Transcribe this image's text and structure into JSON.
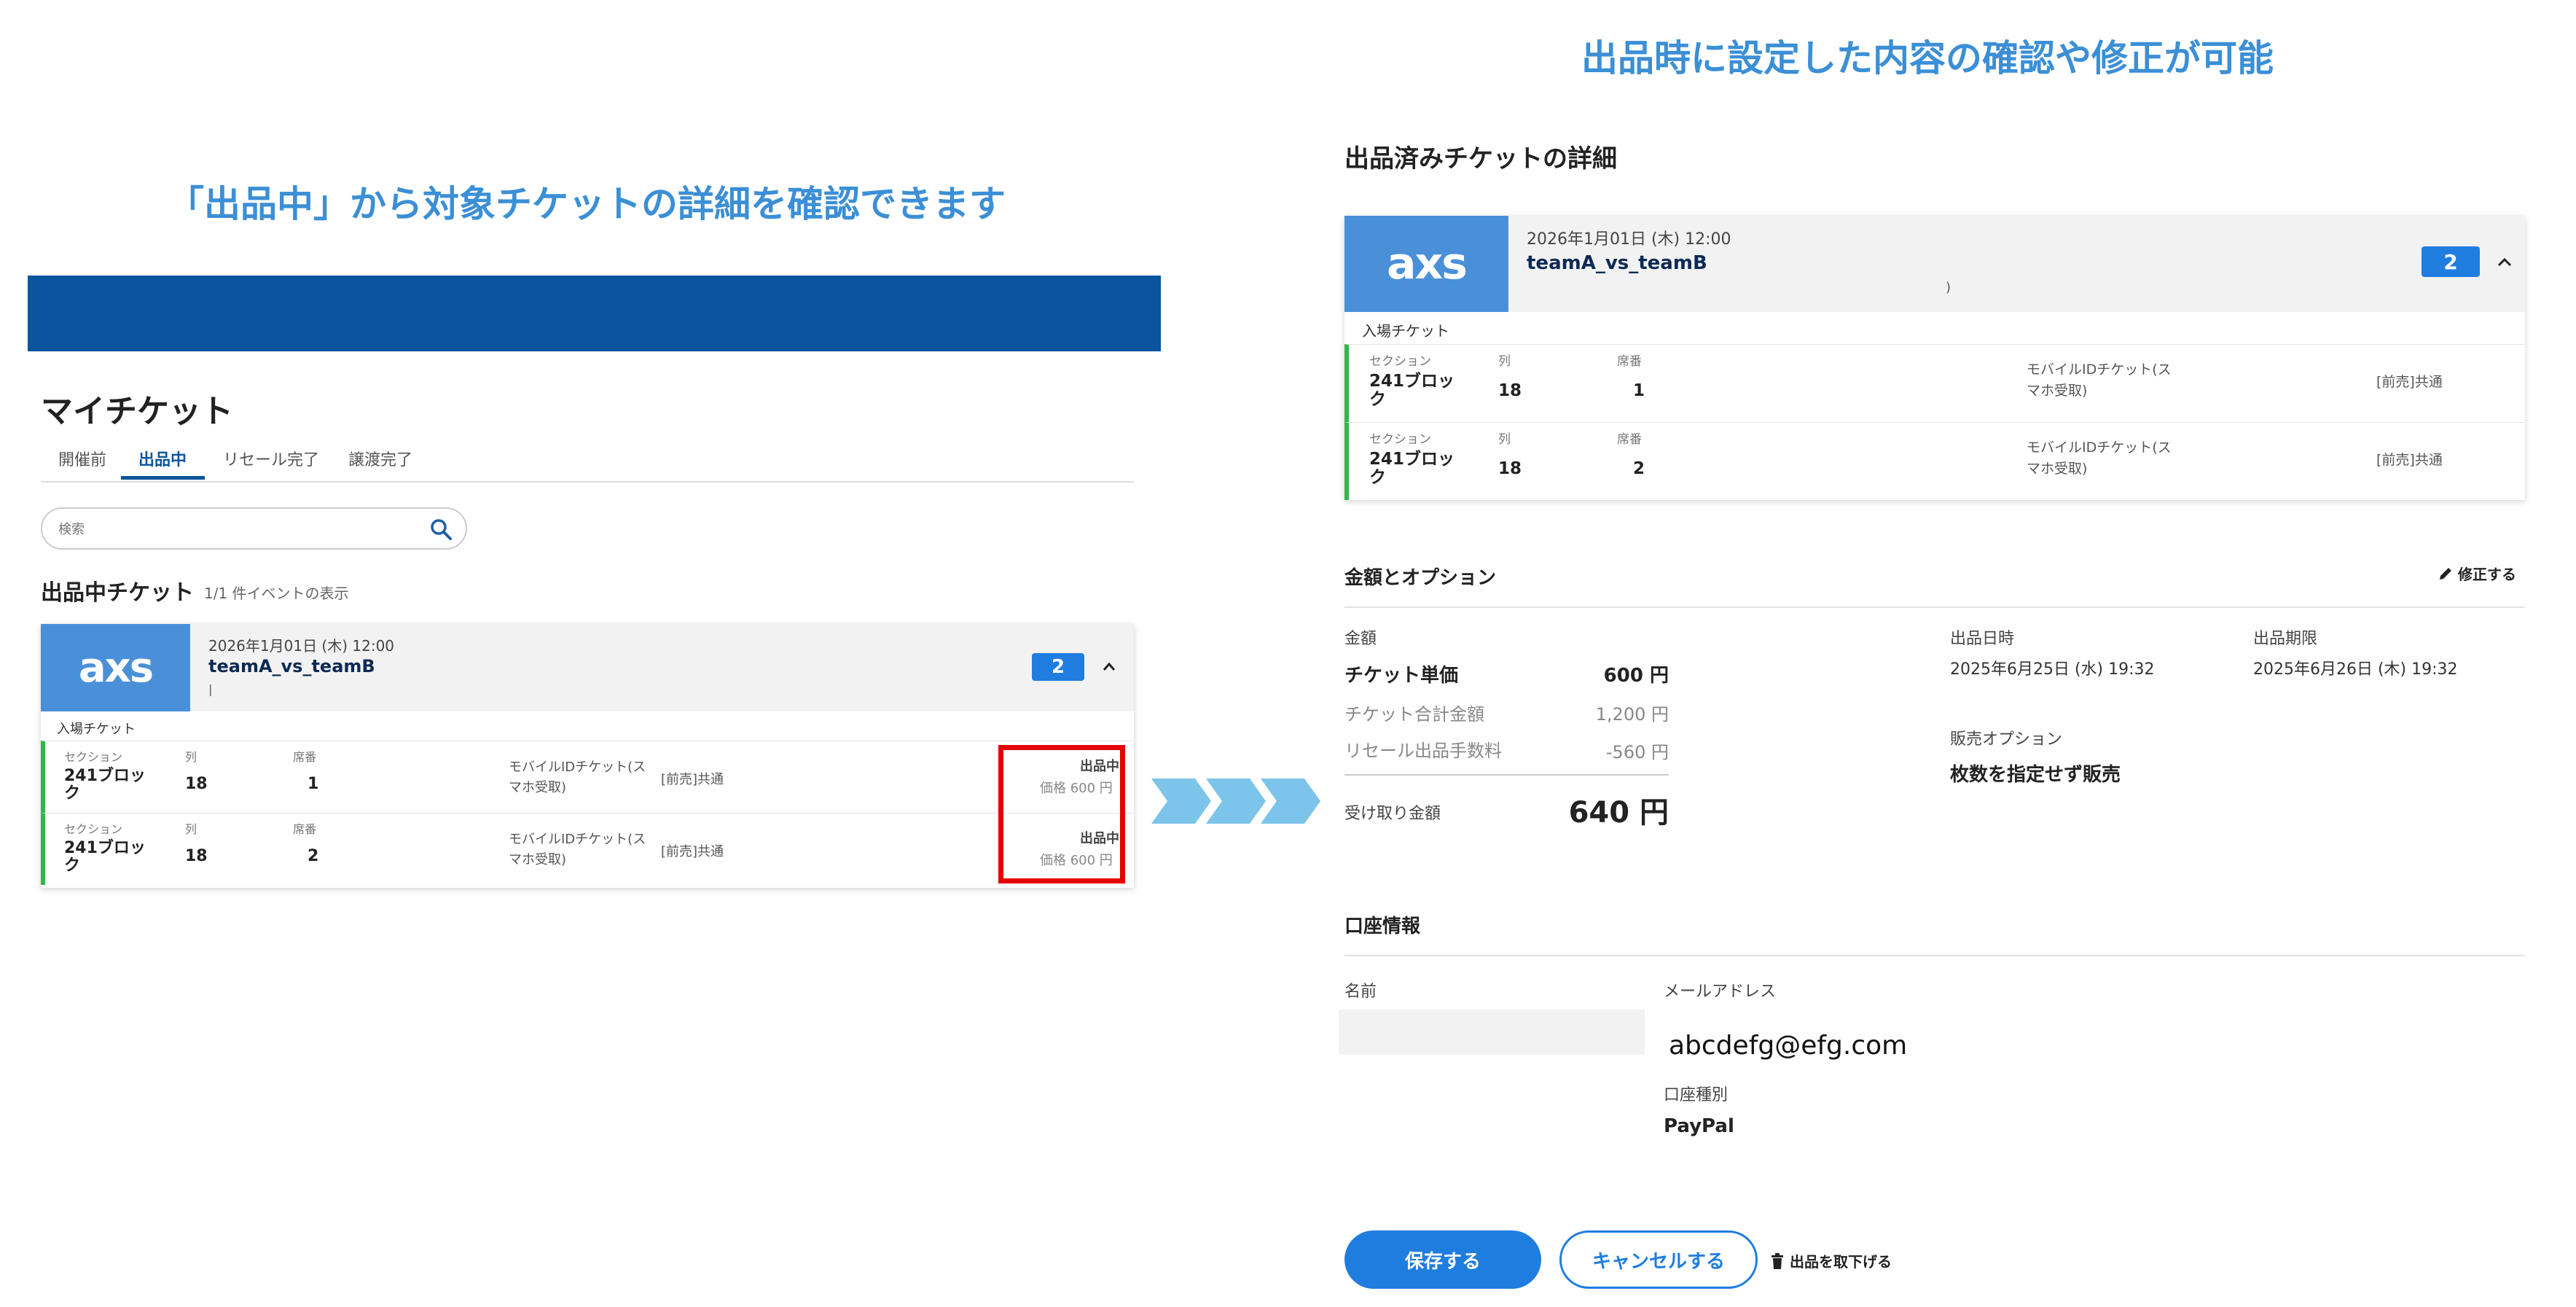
{
  "captions": {
    "left": "「出品中」から対象チケットの詳細を確認できます",
    "right": "出品時に設定した内容の確認や修正が可能"
  },
  "left_screen": {
    "page_title": "マイチケット",
    "tabs": [
      {
        "label": "開催前",
        "active": false
      },
      {
        "label": "出品中",
        "active": true
      },
      {
        "label": "リセール完了",
        "active": false
      },
      {
        "label": "譲渡完了",
        "active": false
      }
    ],
    "search": {
      "placeholder": "検索"
    },
    "listing_title": "出品中チケット",
    "listing_count": "1/1 件イベントの表示",
    "event": {
      "logo": "axs",
      "date": "2026年1月01日 (木) 12:00",
      "name": "teamA_vs_teamB",
      "sub": "|",
      "count": "2",
      "entry_label": "入場チケット"
    },
    "column_labels": {
      "section": "セクション",
      "row": "列",
      "seat": "席番"
    },
    "tickets": [
      {
        "section": "241ブロック",
        "row": "18",
        "seat": "1",
        "type": "モバイルIDチケット(スマホ受取)",
        "price_type": "[前売]共通",
        "status": "出品中",
        "price": "価格 600 円"
      },
      {
        "section": "241ブロック",
        "row": "18",
        "seat": "2",
        "type": "モバイルIDチケット(スマホ受取)",
        "price_type": "[前売]共通",
        "status": "出品中",
        "price": "価格 600 円"
      }
    ]
  },
  "right_screen": {
    "title": "出品済みチケットの詳細",
    "event": {
      "logo": "axs",
      "date": "2026年1月01日 (木) 12:00",
      "name": "teamA_vs_teamB",
      "sub": ")",
      "count": "2",
      "entry_label": "入場チケット"
    },
    "column_labels": {
      "section": "セクション",
      "row": "列",
      "seat": "席番"
    },
    "tickets": [
      {
        "section": "241ブロック",
        "row": "18",
        "seat": "1",
        "type": "モバイルIDチケット(スマホ受取)",
        "price_type": "[前売]共通"
      },
      {
        "section": "241ブロック",
        "row": "18",
        "seat": "2",
        "type": "モバイルIDチケット(スマホ受取)",
        "price_type": "[前売]共通"
      }
    ],
    "price_section": {
      "title": "金額とオプション",
      "edit_label": "修正する",
      "amount_label": "金額",
      "unit_price_label": "チケット単価",
      "unit_price": "600 円",
      "total_label": "チケット合計金額",
      "total": "1,200 円",
      "fee_label": "リセール出品手数料",
      "fee": "-560 円",
      "receive_label": "受け取り金額",
      "receive": "640 円",
      "listed_at_label": "出品日時",
      "listed_at": "2025年6月25日 (水) 19:32",
      "deadline_label": "出品期限",
      "deadline": "2025年6月26日 (木) 19:32",
      "option_label": "販売オプション",
      "option": "枚数を指定せず販売"
    },
    "account_section": {
      "title": "口座情報",
      "name_label": "名前",
      "name_value": "",
      "email_label": "メールアドレス",
      "email": "abcdefg@efg.com",
      "type_label": "口座種別",
      "type": "PayPal"
    },
    "buttons": {
      "save": "保存する",
      "cancel": "キャンセルする",
      "withdraw": "出品を取下げる"
    }
  },
  "colors": {
    "header_blue": "#0a559e",
    "accent_blue": "#1f7de0",
    "caption_blue": "#3b8fd6",
    "highlight_red": "#e50000",
    "row_green": "#2fb84a",
    "arrow_blue": "#7cc4ea"
  }
}
